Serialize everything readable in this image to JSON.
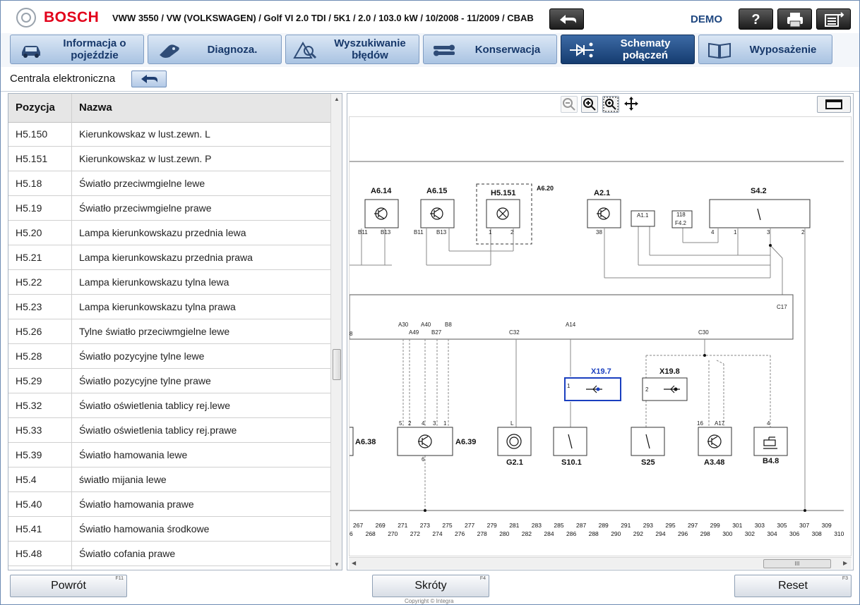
{
  "header": {
    "brand": "BOSCH",
    "vehicle": "VWW 3550 / VW (VOLKSWAGEN) / Golf VI 2.0 TDI / 5K1 / 2.0 / 103.0 kW / 10/2008 - 11/2009 / CBAB",
    "demo_label": "DEMO",
    "help_label": "?",
    "icons": [
      "back-arrow-icon",
      "help-icon",
      "print-icon",
      "menu-export-icon"
    ]
  },
  "tabs": [
    {
      "label": "Informacja o pojeździe",
      "icon": "car-icon",
      "active": false
    },
    {
      "label": "Diagnoza.",
      "icon": "diagnostic-plug-icon",
      "active": false
    },
    {
      "label": "Wyszukiwanie błędów",
      "icon": "warning-search-icon",
      "active": false
    },
    {
      "label": "Konserwacja",
      "icon": "wrench-icon",
      "active": false
    },
    {
      "label": "Schematy połączeń",
      "icon": "circuit-diode-icon",
      "active": true
    },
    {
      "label": "Wyposażenie",
      "icon": "book-icon",
      "active": false
    }
  ],
  "subheader": {
    "title": "Centrala elektroniczna"
  },
  "table": {
    "headers": [
      "Pozycja",
      "Nazwa"
    ],
    "rows": [
      {
        "pos": "H5.150",
        "name": "Kierunkowskaz w lust.zewn. L"
      },
      {
        "pos": "H5.151",
        "name": "Kierunkowskaz w lust.zewn. P"
      },
      {
        "pos": "H5.18",
        "name": "Światło przeciwmgielne lewe"
      },
      {
        "pos": "H5.19",
        "name": "Światło przeciwmgielne prawe"
      },
      {
        "pos": "H5.20",
        "name": "Lampa kierunkowskazu przednia lewa"
      },
      {
        "pos": "H5.21",
        "name": "Lampa kierunkowskazu przednia prawa"
      },
      {
        "pos": "H5.22",
        "name": "Lampa kierunkowskazu tylna lewa"
      },
      {
        "pos": "H5.23",
        "name": "Lampa kierunkowskazu tylna prawa"
      },
      {
        "pos": "H5.26",
        "name": "Tylne światło przeciwmgielne lewe"
      },
      {
        "pos": "H5.28",
        "name": "Światło pozycyjne tylne lewe"
      },
      {
        "pos": "H5.29",
        "name": "Światło pozycyjne tylne prawe"
      },
      {
        "pos": "H5.32",
        "name": "Światło oświetlenia tablicy rej.lewe"
      },
      {
        "pos": "H5.33",
        "name": "Światło oświetlenia tablicy rej.prawe"
      },
      {
        "pos": "H5.39",
        "name": "Światło hamowania lewe"
      },
      {
        "pos": "H5.4",
        "name": "światło mijania lewe"
      },
      {
        "pos": "H5.40",
        "name": "Światło hamowania prawe"
      },
      {
        "pos": "H5.41",
        "name": "Światło hamowania środkowe"
      },
      {
        "pos": "H5.48",
        "name": "Światło cofania prawe"
      }
    ]
  },
  "diagram": {
    "tools": [
      "zoom-out-icon",
      "zoom-in-icon",
      "zoom-fit-icon",
      "pan-icon",
      "fullscreen-icon"
    ],
    "top_components": [
      {
        "name": "A6.14",
        "pins": [
          "B11",
          "B13"
        ]
      },
      {
        "name": "A6.15",
        "pins": [
          "B11",
          "B13"
        ]
      },
      {
        "name": "H5.151",
        "pins": [
          "1",
          "2"
        ]
      },
      {
        "name": "A6.20",
        "pins": []
      },
      {
        "name": "A2.1",
        "pins": [
          "38"
        ]
      },
      {
        "name": "S4.2",
        "pins": [
          "4",
          "1",
          "3",
          "2"
        ]
      }
    ],
    "top_small_boxes": [
      {
        "name": "A1.1"
      },
      {
        "name": "118",
        "sub": "F4.2"
      }
    ],
    "bus_pins": [
      "8",
      "A30",
      "A49",
      "A40",
      "B27",
      "B8",
      "C32",
      "A14",
      "C30",
      "C17"
    ],
    "mid_components": [
      {
        "name": "X19.7",
        "pin": "1"
      },
      {
        "name": "X19.8",
        "pin": "2"
      }
    ],
    "bottom_components": [
      {
        "name": "A6.38",
        "pins": []
      },
      {
        "name": "A6.39",
        "pins": [
          "5",
          "2",
          "4",
          "3",
          "1",
          "6"
        ]
      },
      {
        "name": "G2.1",
        "pins": [
          "L"
        ]
      },
      {
        "name": "S10.1",
        "pins": []
      },
      {
        "name": "S25",
        "pins": []
      },
      {
        "name": "A3.48",
        "pins": [
          "16",
          "A17"
        ]
      },
      {
        "name": "B4.8",
        "pins": [
          "4"
        ]
      }
    ],
    "grid_top": [
      "267",
      "269",
      "271",
      "273",
      "275",
      "277",
      "279",
      "281",
      "283",
      "285",
      "287",
      "289",
      "291",
      "293",
      "295",
      "297",
      "299",
      "301",
      "303",
      "305",
      "307",
      "309"
    ],
    "grid_bottom": [
      "6",
      "268",
      "270",
      "272",
      "274",
      "276",
      "278",
      "280",
      "282",
      "284",
      "286",
      "288",
      "290",
      "292",
      "294",
      "296",
      "298",
      "300",
      "302",
      "304",
      "306",
      "308",
      "310"
    ],
    "scroll_grip": "III"
  },
  "buttons": {
    "back": {
      "label": "Powrót",
      "key": "F11"
    },
    "shortcuts": {
      "label": "Skróty",
      "key": "F4"
    },
    "reset": {
      "label": "Reset",
      "key": "F3"
    }
  },
  "footer": {
    "copyright": "Copyright © Integra"
  },
  "colors": {
    "brand_red": "#e2001a",
    "tab_active": "#1f4780",
    "selected_component": "#1a3fbf"
  }
}
